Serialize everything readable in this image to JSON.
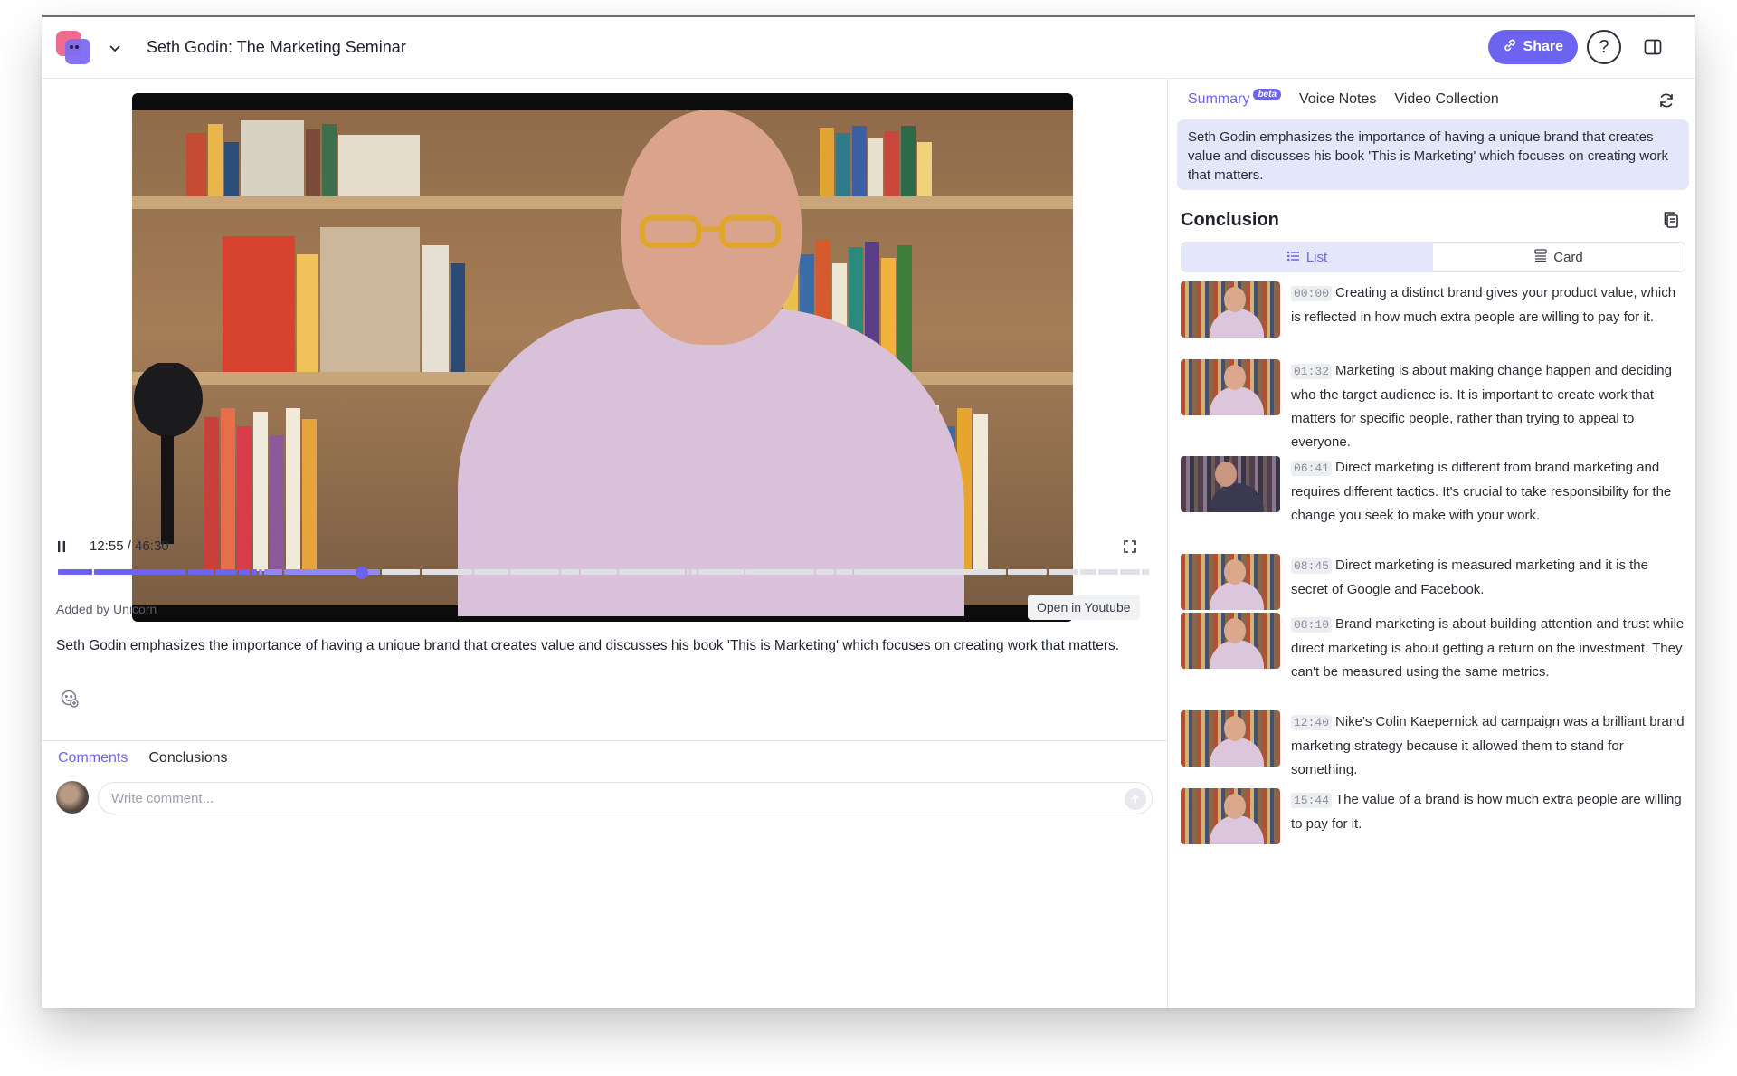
{
  "header": {
    "title": "Seth Godin: The Marketing Seminar",
    "share_label": "Share",
    "help_label": "?"
  },
  "player": {
    "time": "12:55 / 46:30",
    "progress_fraction": 0.278,
    "buffered_fraction": 0.278
  },
  "video_info": {
    "added_by": "Added by Unicorn",
    "open_youtube": "Open in Youtube",
    "description": "Seth Godin emphasizes the importance of having a unique brand that creates value and discusses his book 'This is Marketing' which focuses on creating work that matters."
  },
  "bottom_tabs": [
    {
      "label": "Comments",
      "active": true
    },
    {
      "label": "Conclusions",
      "active": false
    }
  ],
  "comment": {
    "placeholder": "Write comment..."
  },
  "right_tabs": [
    {
      "label": "Summary",
      "badge": "beta",
      "active": true
    },
    {
      "label": "Voice Notes",
      "active": false
    },
    {
      "label": "Video Collection",
      "active": false
    }
  ],
  "summary_text": "Seth Godin emphasizes the importance of having a unique brand that creates value and discusses his book 'This is Marketing' which focuses on creating work that matters.",
  "conclusion": {
    "title": "Conclusion",
    "view_list": "List",
    "view_card": "Card",
    "items": [
      {
        "ts": "00:00",
        "text": "Creating a distinct brand gives your product value, which is reflected in how much extra people are willing to pay for it."
      },
      {
        "ts": "01:32",
        "text": "Marketing is about making change happen and deciding who the target audience is. It is important to create work that matters for specific people, rather than trying to appeal to everyone."
      },
      {
        "ts": "06:41",
        "text": "Direct marketing is different from brand marketing and requires different tactics. It's crucial to take responsibility for the change you seek to make with your work."
      },
      {
        "ts": "08:45",
        "text": "Direct marketing is measured marketing and it is the secret of Google and Facebook."
      },
      {
        "ts": "08:10",
        "text": "Brand marketing is about building attention and trust while direct marketing is about getting a return on the investment. They can't be measured using the same metrics."
      },
      {
        "ts": "12:40",
        "text": "Nike's Colin Kaepernick ad campaign was a brilliant brand marketing strategy because it allowed them to stand for something."
      },
      {
        "ts": "15:44",
        "text": "The value of a brand is how much extra people are willing to pay for it."
      }
    ]
  },
  "colors": {
    "accent": "#6c63f1",
    "summary_bg": "#e3e7f9"
  }
}
